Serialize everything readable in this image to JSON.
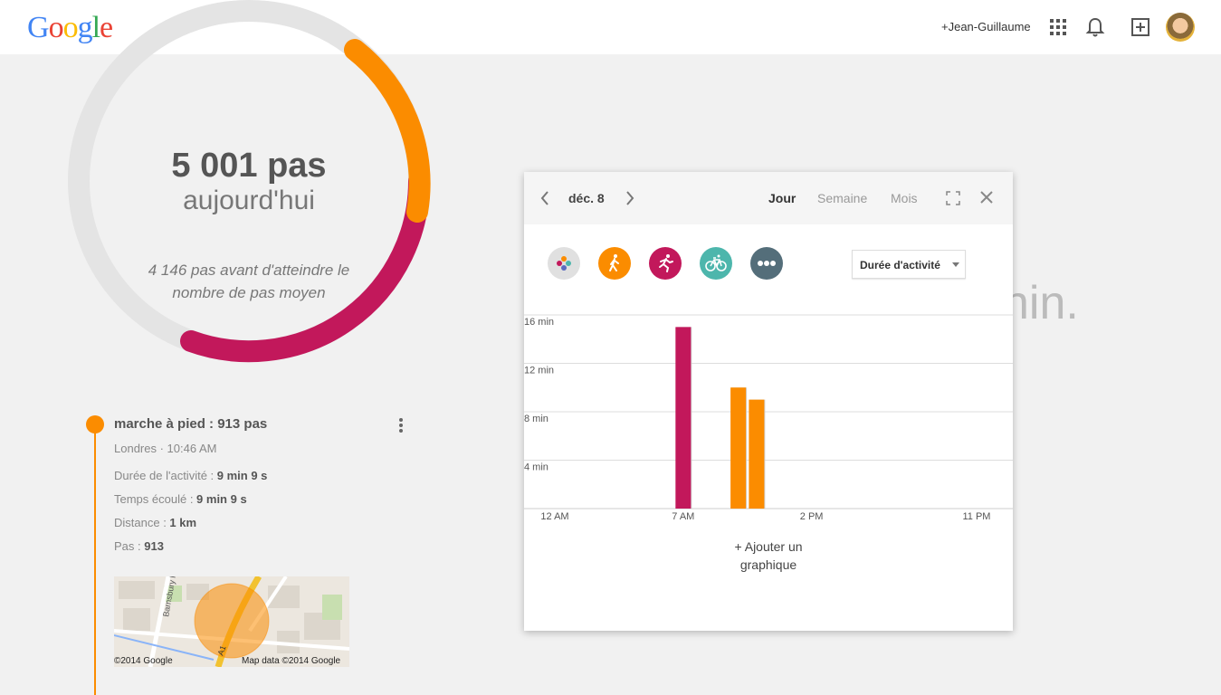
{
  "header": {
    "logo_letters": [
      "G",
      "o",
      "o",
      "g",
      "l",
      "e"
    ],
    "user_link": "+Jean-Guillaume",
    "icons": [
      "apps-icon",
      "bell-icon",
      "share-icon",
      "avatar"
    ]
  },
  "summary": {
    "steps": "5 001 pas",
    "subtitle": "aujourd'hui",
    "note_line1": "4 146 pas avant d'atteindre le",
    "note_line2": "nombre de pas moyen",
    "ring_colors": {
      "track": "#e4e4e4",
      "walk": "#fb8c00",
      "run": "#c2185b"
    }
  },
  "activity": {
    "title": "marche à pied : 913 pas",
    "location": "Londres · 10:46 AM",
    "rows": [
      {
        "label": "Durée de l'activité : ",
        "value": "9 min 9 s"
      },
      {
        "label": "Temps écoulé : ",
        "value": "9 min 9 s"
      },
      {
        "label": "Distance : ",
        "value": "1 km"
      },
      {
        "label": "Pas : ",
        "value": "913"
      }
    ],
    "map": {
      "street_label_1": "Barnsbury Rd",
      "street_label_2": "A1",
      "credit_left": "©2014 Google",
      "credit_right": "Map data ©2014 Google"
    },
    "color": "#fb8c00"
  },
  "background_text": "nin.",
  "card": {
    "date": "déc. 8",
    "tabs": [
      "Jour",
      "Semaine",
      "Mois"
    ],
    "active_tab": "Jour",
    "filters": [
      "all-activities",
      "walking",
      "running",
      "cycling",
      "more"
    ],
    "metric_select": "Durée d'activité",
    "add_chart_line1": "+ Ajouter un",
    "add_chart_line2": "graphique"
  },
  "chart_data": {
    "type": "bar",
    "ylabel": "",
    "xlabel": "",
    "y_ticks": [
      "4 min",
      "8 min",
      "12 min",
      "16 min"
    ],
    "y_tick_values": [
      4,
      8,
      12,
      16
    ],
    "x_ticks": [
      "12 AM",
      "7 AM",
      "2 PM",
      "11 PM"
    ],
    "x_tick_hours": [
      0,
      7,
      14,
      23
    ],
    "ylim": [
      0,
      16
    ],
    "bars": [
      {
        "hour": 7,
        "minutes": 15,
        "activity": "running",
        "color": "#c2185b"
      },
      {
        "hour": 10,
        "minutes": 10,
        "activity": "walking",
        "color": "#fb8c00"
      },
      {
        "hour": 11,
        "minutes": 9,
        "activity": "walking",
        "color": "#fb8c00"
      }
    ],
    "grid": true
  }
}
